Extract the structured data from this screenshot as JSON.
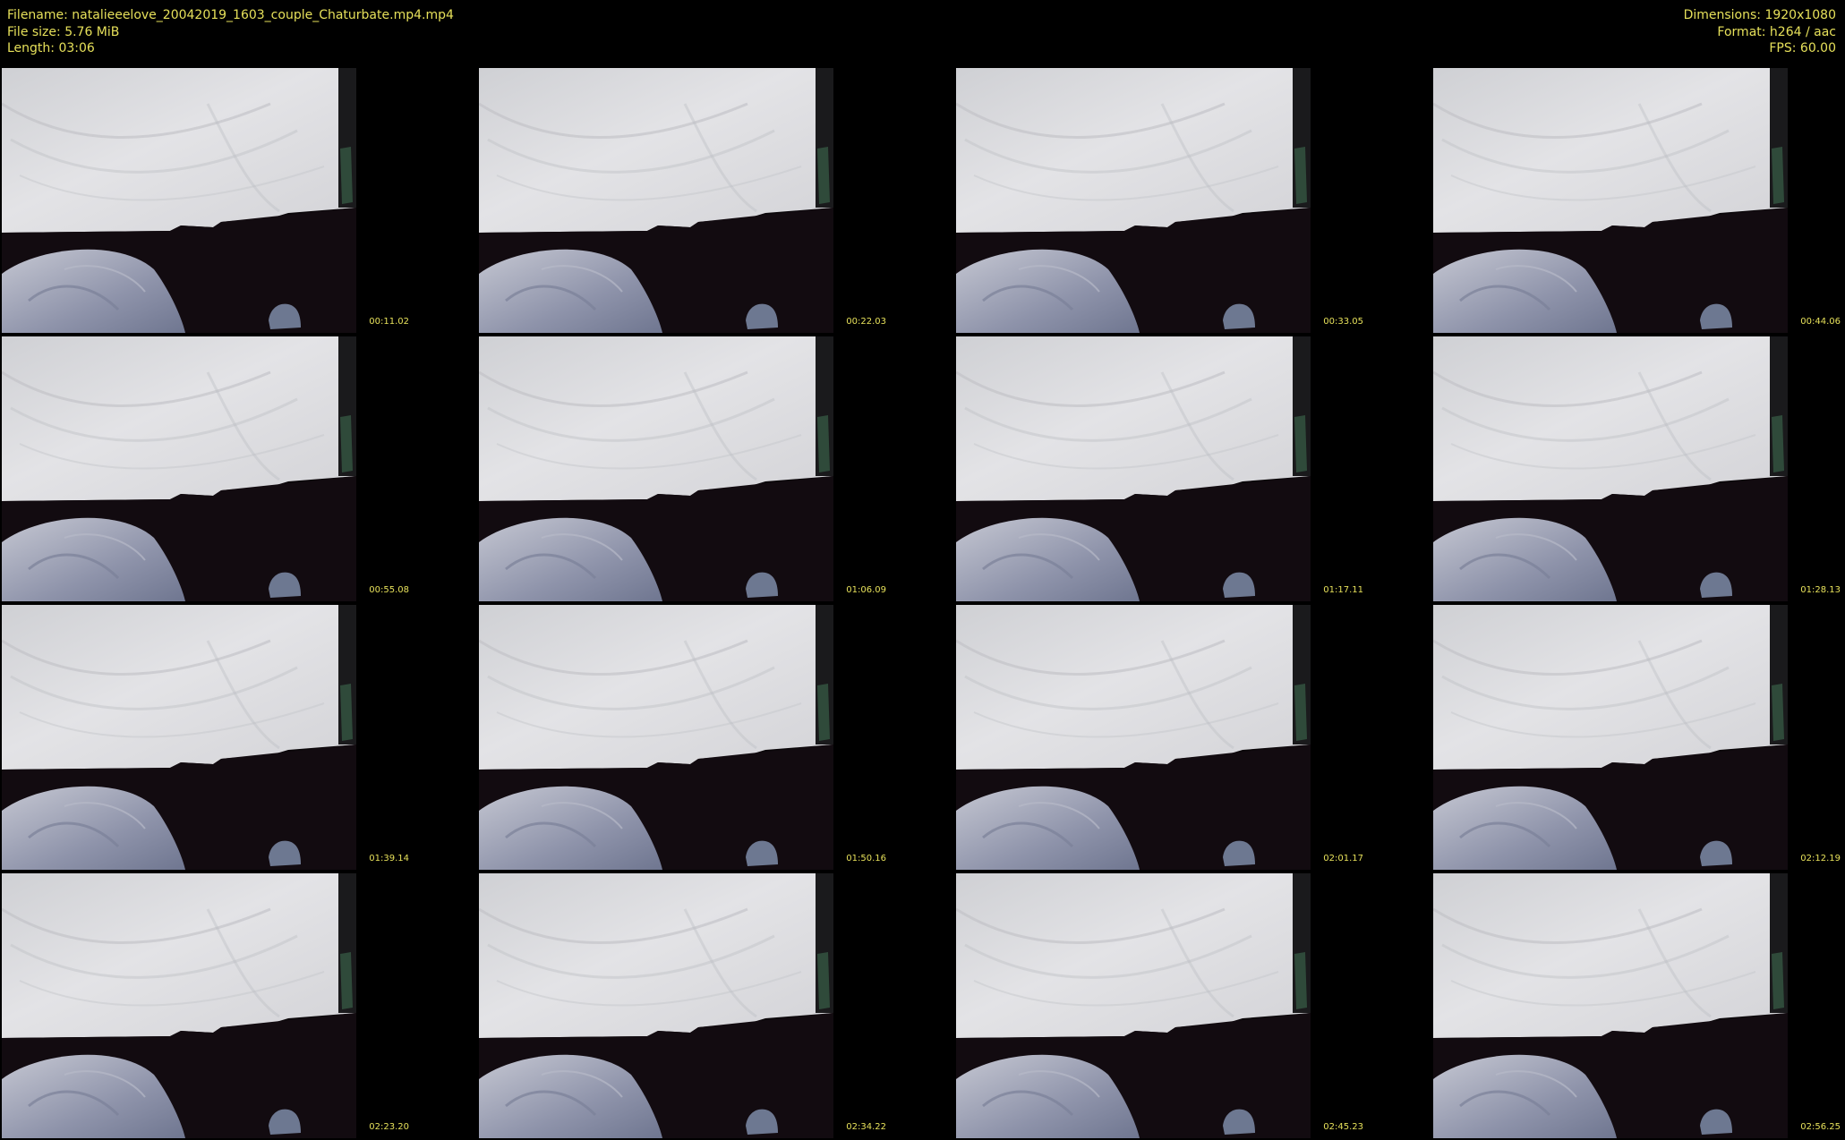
{
  "header": {
    "filename": "Filename: natalieeelove_20042019_1603_couple_Chaturbate.mp4.mp4",
    "filesize": "File size: 5.76 MiB",
    "length": "Length: 03:06",
    "dimensions": "Dimensions: 1920x1080",
    "format": "Format: h264 / aac",
    "fps": "FPS: 60.00"
  },
  "thumbnails": [
    {
      "timestamp": "00:11.02"
    },
    {
      "timestamp": "00:22.03"
    },
    {
      "timestamp": "00:33.05"
    },
    {
      "timestamp": "00:44.06"
    },
    {
      "timestamp": "00:55.08"
    },
    {
      "timestamp": "01:06.09"
    },
    {
      "timestamp": "01:17.11"
    },
    {
      "timestamp": "01:28.13"
    },
    {
      "timestamp": "01:39.14"
    },
    {
      "timestamp": "01:50.16"
    },
    {
      "timestamp": "02:01.17"
    },
    {
      "timestamp": "02:12.19"
    },
    {
      "timestamp": "02:23.20"
    },
    {
      "timestamp": "02:34.22"
    },
    {
      "timestamp": "02:45.23"
    },
    {
      "timestamp": "02:56.25"
    }
  ],
  "colors": {
    "text": "#e6e05a",
    "background": "#000000",
    "curtain": "#d9d9dc",
    "sofa": "#120b10",
    "pillow": "#9fa3b5"
  }
}
